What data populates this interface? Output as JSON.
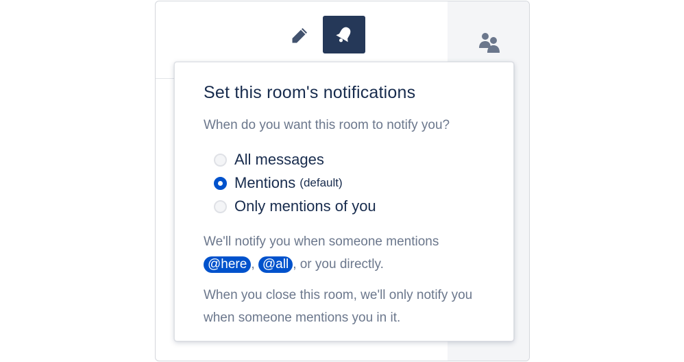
{
  "toolbar": {
    "edit_icon": "pencil-icon",
    "notifications_icon": "bell-icon",
    "people_icon": "people-icon"
  },
  "colors": {
    "accent": "#0052cc",
    "header_button": "#253858",
    "text_primary": "#172b4d",
    "text_secondary": "#6b778c",
    "presence": "#36b37e"
  },
  "popover": {
    "title": "Set this room's notifications",
    "question": "When do you want this room to notify you?",
    "options": [
      {
        "label": "All messages",
        "sub": "",
        "selected": false
      },
      {
        "label": "Mentions",
        "sub": "(default)",
        "selected": true
      },
      {
        "label": "Only mentions of you",
        "sub": "",
        "selected": false
      }
    ],
    "notify_text_pre": "We'll notify you when someone mentions",
    "mention_here": "@here",
    "comma": ",",
    "mention_all": "@all",
    "notify_text_post": ", or you directly.",
    "closed_text": "When you close this room, we'll only notify you when someone mentions you in it."
  }
}
